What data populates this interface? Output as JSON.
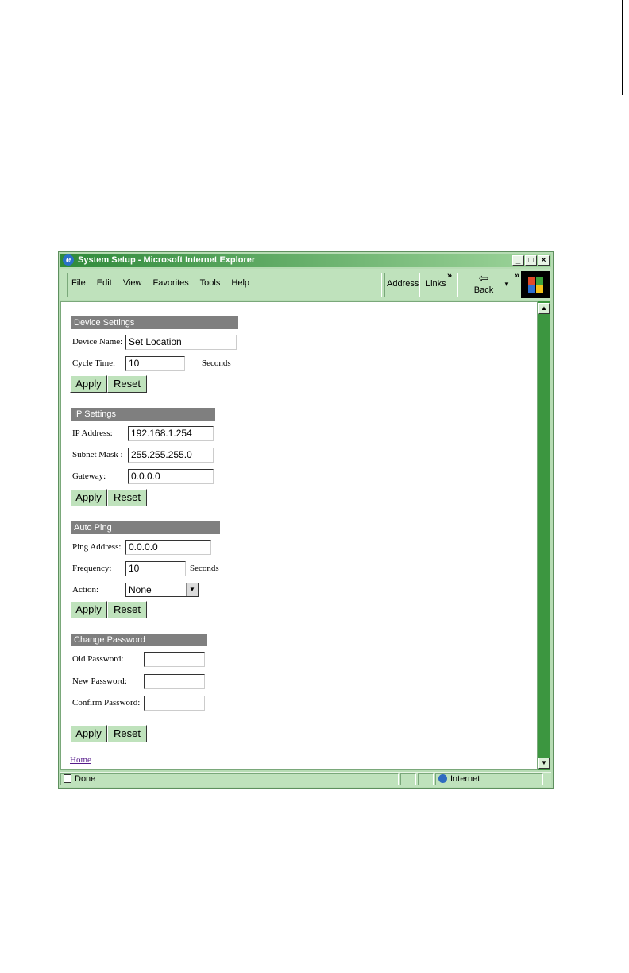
{
  "window": {
    "title": "System Setup - Microsoft Internet Explorer",
    "controls": {
      "minimize": "_",
      "maximize": "□",
      "close": "×"
    }
  },
  "menu": [
    "File",
    "Edit",
    "View",
    "Favorites",
    "Tools",
    "Help"
  ],
  "toolbar": {
    "address_label": "Address",
    "links_label": "Links",
    "chevron": "»",
    "back_label": "Back"
  },
  "icons": {
    "back": "left-arrow-icon",
    "ie": "internet-explorer-icon",
    "logo": "windows-logo-icon",
    "zone": "globe-icon",
    "page": "page-icon"
  },
  "device_settings": {
    "header": "Device Settings",
    "device_name_label": "Device Name:",
    "device_name_value": "Set Location",
    "cycle_time_label": "Cycle Time:",
    "cycle_time_value": "10",
    "cycle_time_unit": "Seconds",
    "apply": "Apply",
    "reset": "Reset"
  },
  "ip_settings": {
    "header": "IP Settings",
    "ip_address_label": "IP Address:",
    "ip_address_value": "192.168.1.254",
    "subnet_mask_label": "Subnet Mask :",
    "subnet_mask_value": "255.255.255.0",
    "gateway_label": "Gateway:",
    "gateway_value": "0.0.0.0",
    "apply": "Apply",
    "reset": "Reset"
  },
  "auto_ping": {
    "header": "Auto Ping",
    "ping_address_label": "Ping Address:",
    "ping_address_value": "0.0.0.0",
    "frequency_label": "Frequency:",
    "frequency_value": "10",
    "frequency_unit": "Seconds",
    "action_label": "Action:",
    "action_value": "None",
    "apply": "Apply",
    "reset": "Reset"
  },
  "change_password": {
    "header": "Change Password",
    "old_label": "Old Password:",
    "old_value": "",
    "new_label": "New Password:",
    "new_value": "",
    "confirm_label": "Confirm Password:",
    "confirm_value": "",
    "apply": "Apply",
    "reset": "Reset"
  },
  "home_link": "Home",
  "status": {
    "text": "Done",
    "zone": "Internet"
  },
  "colors": {
    "chrome": "#bfe2bc",
    "title_start": "#2f8a3a",
    "section_header": "#7f7f7f",
    "scrollbar": "#3c9640"
  }
}
